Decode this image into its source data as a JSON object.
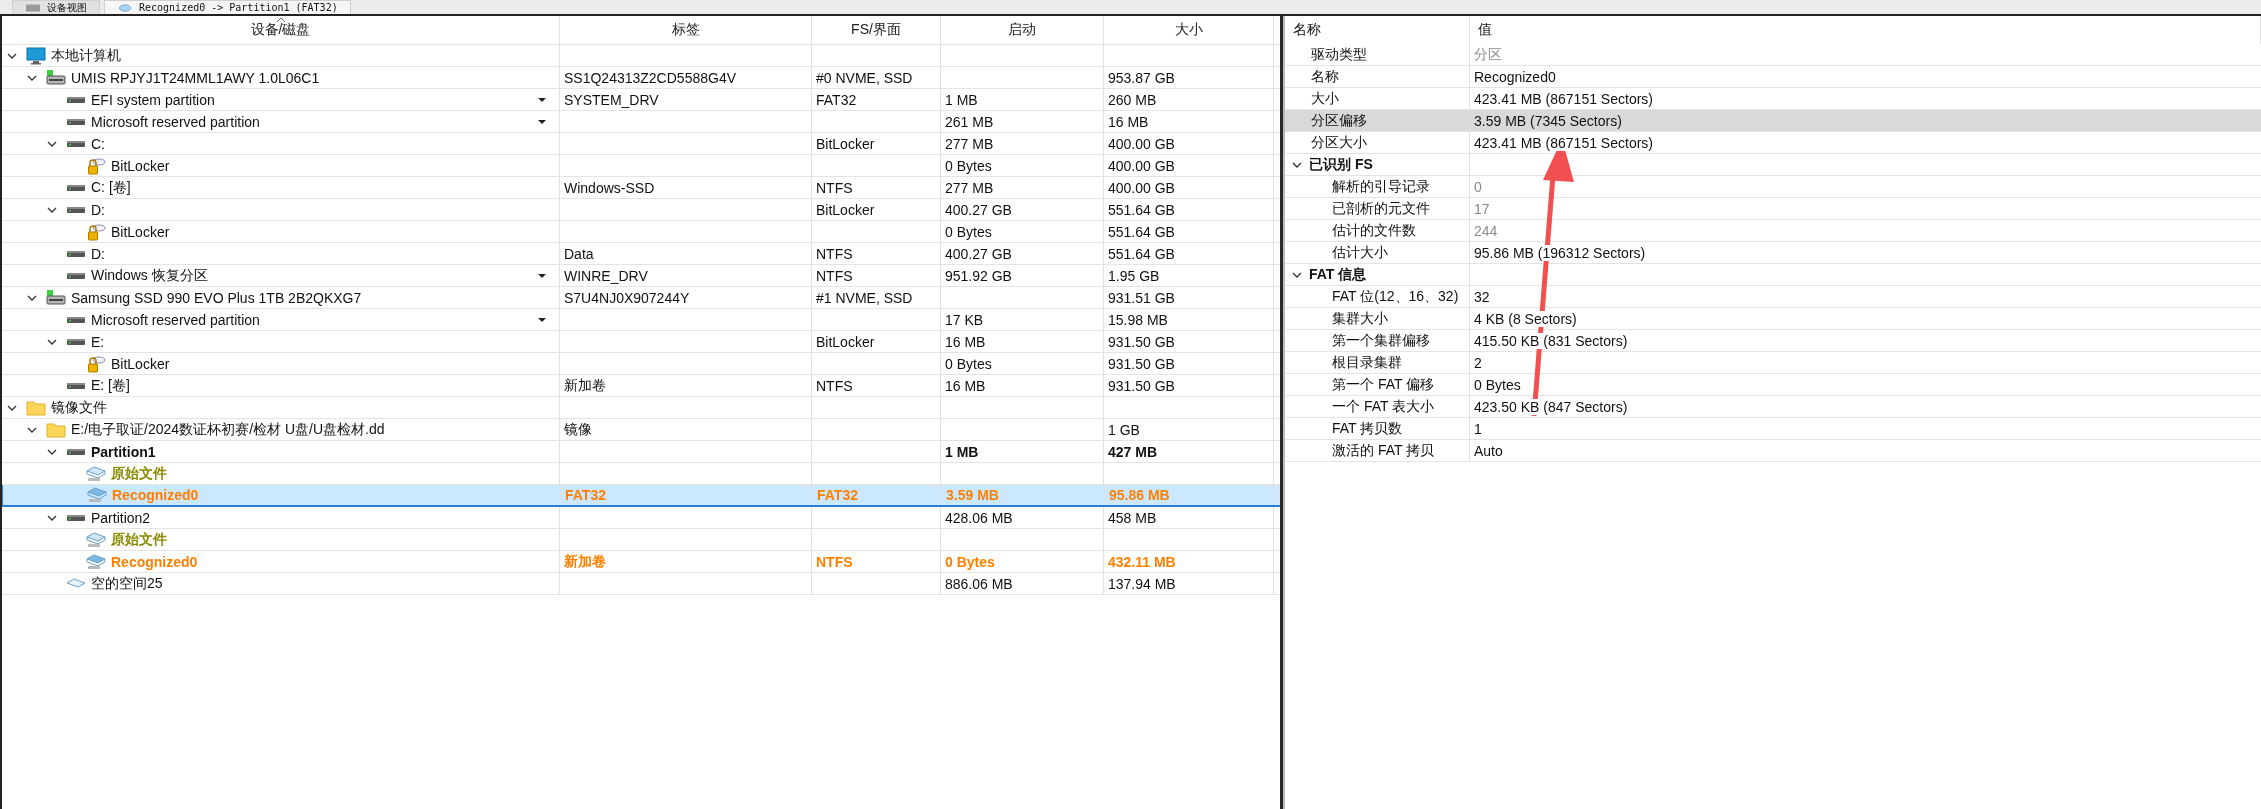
{
  "tabs": [
    {
      "label": "设备视图",
      "kind": "drive",
      "selected": false
    },
    {
      "label": "Recognized0 -> Partition1 (FAT32)",
      "kind": "rec",
      "selected": true
    }
  ],
  "device_table": {
    "columns": [
      {
        "label": "设备/磁盘",
        "sorted": true
      },
      {
        "label": "标签",
        "sorted": false
      },
      {
        "label": "FS/界面",
        "sorted": false
      },
      {
        "label": "启动",
        "sorted": false
      },
      {
        "label": "大小",
        "sorted": false
      }
    ],
    "rows": [
      {
        "name": "本地计算机",
        "kind": "computer",
        "expanded": true,
        "selected": false,
        "dropdown": false,
        "children": [
          {
            "name": "UMIS RPJYJ1T24MML1AWY 1.0L06C1",
            "kind": "disk",
            "label": "SS1Q24313Z2CD5588G4V",
            "fs": "#0 NVME, SSD",
            "size": "953.87 GB",
            "expanded": true,
            "selected": false,
            "dropdown": false,
            "children": [
              {
                "name": "EFI system partition",
                "kind": "partition",
                "label": "SYSTEM_DRV",
                "fs": "FAT32",
                "start": "1 MB",
                "size": "260 MB",
                "selected": false,
                "dropdown": true
              },
              {
                "name": "Microsoft reserved partition",
                "kind": "partition",
                "start": "261 MB",
                "size": "16 MB",
                "selected": false,
                "dropdown": true
              },
              {
                "name": "C:",
                "kind": "partition",
                "fs": "BitLocker",
                "start": "277 MB",
                "size": "400.00 GB",
                "expanded": true,
                "selected": false,
                "dropdown": false,
                "children": [
                  {
                    "name": "BitLocker",
                    "kind": "bitlocker",
                    "start": "0 Bytes",
                    "size": "400.00 GB",
                    "selected": false,
                    "dropdown": false
                  }
                ]
              },
              {
                "name": "C: [卷]",
                "kind": "partition",
                "label": "Windows-SSD",
                "fs": "NTFS",
                "start": "277 MB",
                "size": "400.00 GB",
                "selected": false,
                "dropdown": false
              },
              {
                "name": "D:",
                "kind": "partition",
                "fs": "BitLocker",
                "start": "400.27 GB",
                "size": "551.64 GB",
                "expanded": true,
                "selected": false,
                "dropdown": false,
                "children": [
                  {
                    "name": "BitLocker",
                    "kind": "bitlocker",
                    "start": "0 Bytes",
                    "size": "551.64 GB",
                    "selected": false,
                    "dropdown": false
                  }
                ]
              },
              {
                "name": "D:",
                "kind": "partition",
                "label": "Data",
                "fs": "NTFS",
                "start": "400.27 GB",
                "size": "551.64 GB",
                "selected": false,
                "dropdown": false
              },
              {
                "name": "Windows 恢复分区",
                "kind": "partition",
                "label": "WINRE_DRV",
                "fs": "NTFS",
                "start": "951.92 GB",
                "size": "1.95 GB",
                "selected": false,
                "dropdown": true
              }
            ]
          },
          {
            "name": "Samsung SSD 990 EVO Plus 1TB 2B2QKXG7",
            "kind": "disk",
            "label": "S7U4NJ0X907244Y",
            "fs": "#1 NVME, SSD",
            "size": "931.51 GB",
            "expanded": true,
            "selected": false,
            "dropdown": false,
            "children": [
              {
                "name": "Microsoft reserved partition",
                "kind": "partition",
                "start": "17 KB",
                "size": "15.98 MB",
                "selected": false,
                "dropdown": true
              },
              {
                "name": "E:",
                "kind": "partition",
                "fs": "BitLocker",
                "start": "16 MB",
                "size": "931.50 GB",
                "expanded": true,
                "selected": false,
                "dropdown": false,
                "children": [
                  {
                    "name": "BitLocker",
                    "kind": "bitlocker",
                    "start": "0 Bytes",
                    "size": "931.50 GB",
                    "selected": false,
                    "dropdown": false
                  }
                ]
              },
              {
                "name": "E: [卷]",
                "kind": "partition",
                "label": "新加卷",
                "fs": "NTFS",
                "start": "16 MB",
                "size": "931.50 GB",
                "selected": false,
                "dropdown": false
              }
            ]
          }
        ]
      },
      {
        "name": "镜像文件",
        "kind": "folder",
        "expanded": true,
        "selected": false,
        "dropdown": false,
        "children": [
          {
            "name": "E:/电子取证/2024数证杯初赛/检材 U盘/U盘检材.dd",
            "kind": "folder",
            "label": "镜像",
            "size": "1 GB",
            "expanded": true,
            "selected": false,
            "dropdown": false,
            "children": [
              {
                "name": "Partition1",
                "kind": "partition",
                "start": "1 MB",
                "size": "427 MB",
                "active": true,
                "expanded": true,
                "selected": false,
                "dropdown": false,
                "children": [
                  {
                    "name": "原始文件",
                    "kind": "raw",
                    "color": "#8a8a00",
                    "selected": false,
                    "dropdown": false
                  },
                  {
                    "name": "Recognized0",
                    "kind": "rec",
                    "label": "FAT32",
                    "fs": "FAT32",
                    "start": "3.59 MB",
                    "size": "95.86 MB",
                    "color": "#ff8000",
                    "selected": true,
                    "dropdown": false
                  }
                ]
              },
              {
                "name": "Partition2",
                "kind": "partition",
                "start": "428.06 MB",
                "size": "458 MB",
                "active": false,
                "expanded": true,
                "selected": false,
                "dropdown": false,
                "children": [
                  {
                    "name": "原始文件",
                    "kind": "raw",
                    "color": "#8a8a00",
                    "selected": false,
                    "dropdown": false
                  },
                  {
                    "name": "Recognized0",
                    "kind": "rec",
                    "label": "新加卷",
                    "fs": "NTFS",
                    "start": "0 Bytes",
                    "size": "432.11 MB",
                    "color": "#ff8000",
                    "selected": false,
                    "dropdown": false
                  }
                ]
              },
              {
                "name": "空的空间25",
                "kind": "free",
                "start": "886.06 MB",
                "size": "137.94 MB",
                "selected": false,
                "dropdown": false
              }
            ]
          }
        ]
      }
    ]
  },
  "properties": {
    "columns": [
      "名称",
      "值"
    ],
    "items": [
      {
        "name": "驱动类型",
        "value": "分区",
        "disabled": true,
        "selected": false
      },
      {
        "name": "名称",
        "value": "Recognized0",
        "disabled": false,
        "selected": false
      },
      {
        "name": "大小",
        "value": "423.41 MB (867151 Sectors)",
        "disabled": false,
        "selected": false
      },
      {
        "name": "分区偏移",
        "value": "3.59 MB (7345 Sectors)",
        "disabled": false,
        "selected": true
      },
      {
        "name": "分区大小",
        "value": "423.41 MB (867151 Sectors)",
        "disabled": false,
        "selected": false
      }
    ],
    "groups": [
      {
        "title": "已识别 FS",
        "expanded": true,
        "items": [
          {
            "name": "解析的引导记录",
            "value": "0",
            "disabled": true,
            "selected": false
          },
          {
            "name": "已剖析的元文件",
            "value": "17",
            "disabled": true,
            "selected": false
          },
          {
            "name": "估计的文件数",
            "value": "244",
            "disabled": true,
            "selected": false
          },
          {
            "name": "估计大小",
            "value": "95.86 MB (196312 Sectors)",
            "disabled": false,
            "selected": false
          }
        ]
      },
      {
        "title": "FAT 信息",
        "expanded": true,
        "items": [
          {
            "name": "FAT 位(12、16、32)",
            "value": "32",
            "disabled": false,
            "selected": false
          },
          {
            "name": "集群大小",
            "value": "4 KB (8 Sectors)",
            "disabled": false,
            "selected": false
          },
          {
            "name": "第一个集群偏移",
            "value": "415.50 KB (831 Sectors)",
            "disabled": false,
            "selected": false
          },
          {
            "name": "根目录集群",
            "value": "2",
            "disabled": false,
            "selected": false
          },
          {
            "name": "第一个 FAT 偏移",
            "value": "0 Bytes",
            "disabled": false,
            "selected": false
          },
          {
            "name": "一个 FAT 表大小",
            "value": "423.50 KB (847 Sectors)",
            "disabled": false,
            "selected": false
          },
          {
            "name": "FAT 拷贝数",
            "value": "1",
            "disabled": false,
            "selected": false
          },
          {
            "name": "激活的 FAT 拷贝",
            "value": "Auto",
            "disabled": false,
            "selected": false
          }
        ]
      }
    ]
  },
  "annotation": {
    "kind": "arrow",
    "color": "#f25050"
  }
}
